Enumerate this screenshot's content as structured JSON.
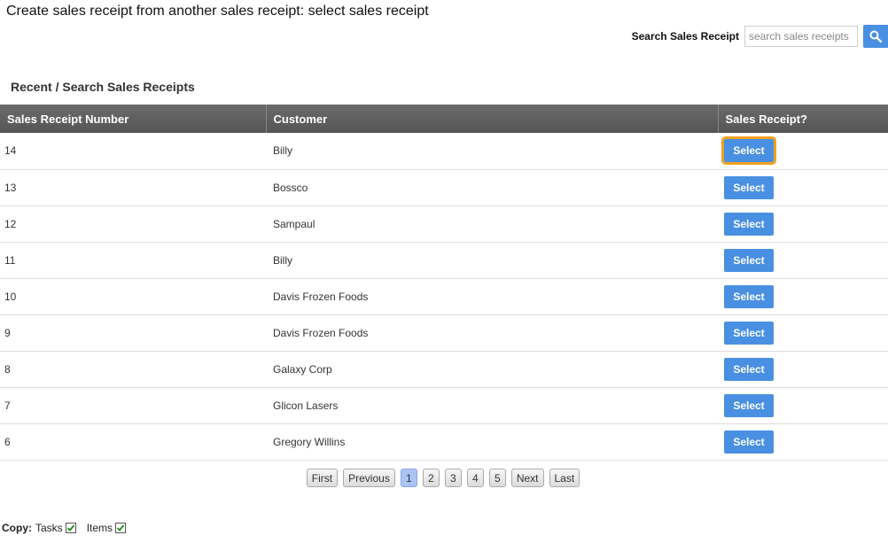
{
  "header": {
    "title": "Create sales receipt from another sales receipt: select sales receipt"
  },
  "search": {
    "label": "Search Sales Receipt",
    "placeholder": "search sales receipts",
    "value": "",
    "button_icon": "search-icon"
  },
  "section": {
    "title": "Recent / Search Sales Receipts"
  },
  "table": {
    "columns": [
      "Sales Receipt Number",
      "Customer",
      "Sales Receipt?"
    ],
    "rows": [
      {
        "number": "14",
        "customer": "Billy",
        "action": "Select"
      },
      {
        "number": "13",
        "customer": "Bossco",
        "action": "Select"
      },
      {
        "number": "12",
        "customer": "Sampaul",
        "action": "Select"
      },
      {
        "number": "11",
        "customer": "Billy",
        "action": "Select"
      },
      {
        "number": "10",
        "customer": "Davis Frozen Foods",
        "action": "Select"
      },
      {
        "number": "9",
        "customer": "Davis Frozen Foods",
        "action": "Select"
      },
      {
        "number": "8",
        "customer": "Galaxy Corp",
        "action": "Select"
      },
      {
        "number": "7",
        "customer": "Glicon Lasers",
        "action": "Select"
      },
      {
        "number": "6",
        "customer": "Gregory Willins",
        "action": "Select"
      }
    ]
  },
  "pagination": {
    "first": "First",
    "previous": "Previous",
    "pages": [
      "1",
      "2",
      "3",
      "4",
      "5"
    ],
    "current": "1",
    "next": "Next",
    "last": "Last"
  },
  "copy": {
    "label": "Copy:",
    "options": [
      {
        "label": "Tasks",
        "checked": true
      },
      {
        "label": "Items",
        "checked": true
      }
    ]
  },
  "colors": {
    "accent": "#4a90e2",
    "header_bg": "#5f5f5f",
    "focus_outline": "#f0a020",
    "current_page": "#a9c4f5",
    "checkmark": "#1a8a1a"
  }
}
